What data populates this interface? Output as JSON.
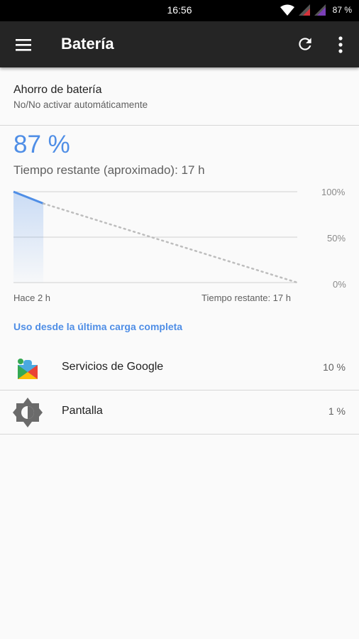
{
  "status_bar": {
    "time": "16:56",
    "battery_text": "87 %"
  },
  "toolbar": {
    "title": "Batería",
    "menu_icon": "hamburger-menu-icon",
    "refresh_icon": "refresh-icon",
    "more_icon": "more-vert-icon"
  },
  "battery_saver": {
    "title": "Ahorro de batería",
    "subtitle": "No/No activar automáticamente"
  },
  "battery": {
    "level": "87 %",
    "time_remaining": "Tiempo restante (aproximado): 17 h"
  },
  "chart_data": {
    "type": "line",
    "y_tick_labels": [
      "100%",
      "50%",
      "0%"
    ],
    "x_tick_labels": [
      "Hace 2 h",
      "Tiempo restante: 17 h"
    ],
    "ylim": [
      0,
      100
    ],
    "grid": true,
    "series": [
      {
        "style": "solid",
        "color": "#4f8ee6",
        "x": [
          0,
          2
        ],
        "y": [
          100,
          87
        ]
      },
      {
        "style": "dotted",
        "color": "#bdbdbd",
        "x": [
          2,
          19
        ],
        "y": [
          87,
          0
        ]
      }
    ]
  },
  "usage": {
    "header": "Uso desde la última carga completa",
    "items": [
      {
        "name": "Servicios de Google",
        "value": "10 %",
        "icon": "google-play-services-icon"
      },
      {
        "name": "Pantalla",
        "value": "1 %",
        "icon": "display-brightness-icon"
      }
    ]
  },
  "colors": {
    "accent": "#4f8ee6",
    "toolbar": "#252525",
    "status_bar": "#000000"
  }
}
